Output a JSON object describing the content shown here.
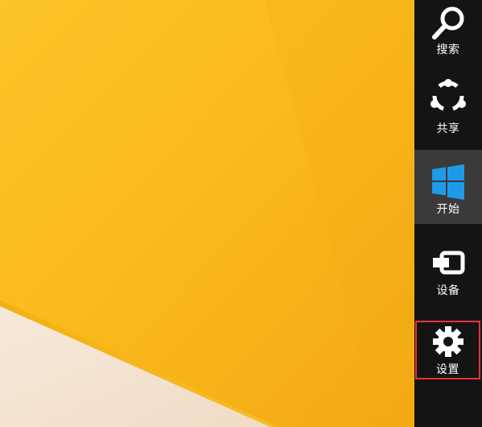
{
  "charms": {
    "search": {
      "label": "搜索",
      "icon": "search-icon"
    },
    "share": {
      "label": "共享",
      "icon": "share-icon"
    },
    "start": {
      "label": "开始",
      "icon": "windows-logo-icon",
      "accent": "#1e9be8"
    },
    "devices": {
      "label": "设备",
      "icon": "devices-icon"
    },
    "settings": {
      "label": "设置",
      "icon": "gear-icon",
      "highlight": "#e5313d"
    }
  },
  "colors": {
    "charms_bg": "#141414",
    "start_bg": "#3a3a3a",
    "wallpaper_yellow": "#f9b91b",
    "wallpaper_cream": "#f4e2cf"
  }
}
